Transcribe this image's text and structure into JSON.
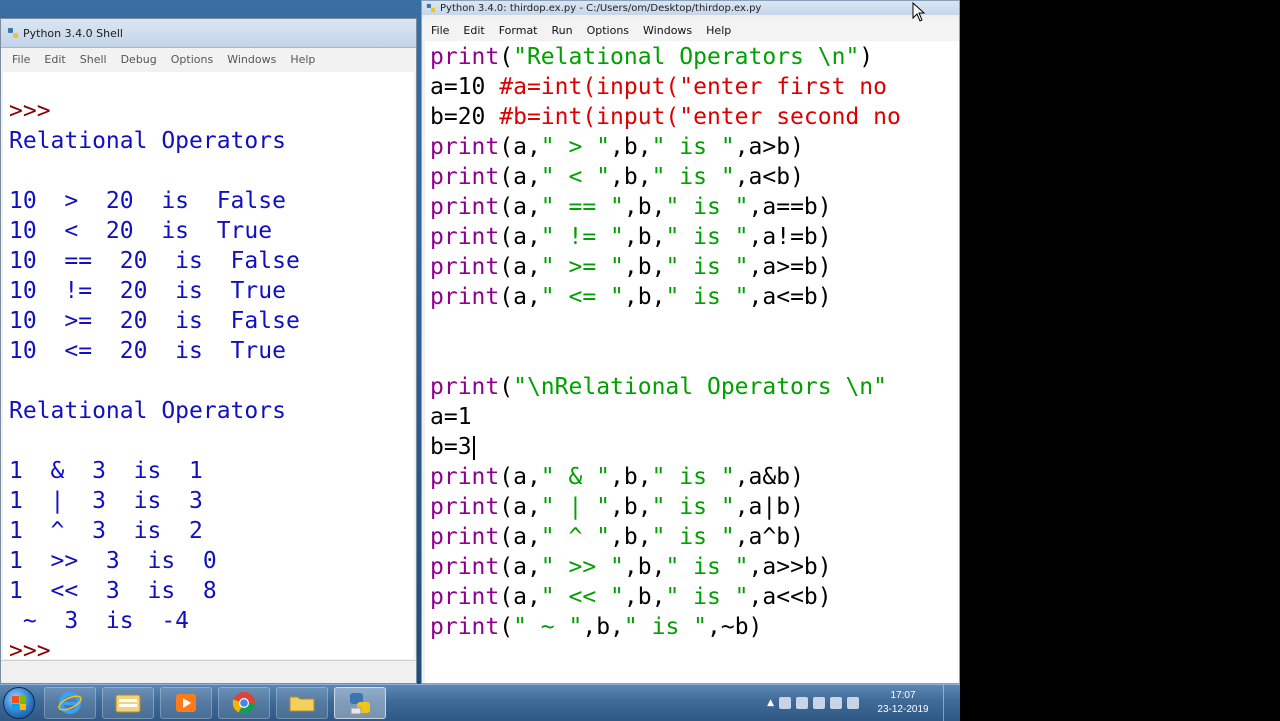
{
  "shell": {
    "title": "Python 3.4.0 Shell",
    "menu": [
      "File",
      "Edit",
      "Shell",
      "Debug",
      "Options",
      "Windows",
      "Help"
    ],
    "lines": [
      [
        {
          "t": ">>>",
          "c": "prompt"
        }
      ],
      [
        {
          "t": "Relational Operators",
          "c": "out"
        }
      ],
      [
        {
          "t": "",
          "c": "out"
        }
      ],
      [
        {
          "t": "10  >  20  is  False",
          "c": "out"
        }
      ],
      [
        {
          "t": "10  <  20  is  True",
          "c": "out"
        }
      ],
      [
        {
          "t": "10  ==  20  is  False",
          "c": "out"
        }
      ],
      [
        {
          "t": "10  !=  20  is  True",
          "c": "out"
        }
      ],
      [
        {
          "t": "10  >=  20  is  False",
          "c": "out"
        }
      ],
      [
        {
          "t": "10  <=  20  is  True",
          "c": "out"
        }
      ],
      [
        {
          "t": "",
          "c": "out"
        }
      ],
      [
        {
          "t": "Relational Operators",
          "c": "out"
        }
      ],
      [
        {
          "t": "",
          "c": "out"
        }
      ],
      [
        {
          "t": "1  &  3  is  1",
          "c": "out"
        }
      ],
      [
        {
          "t": "1  |  3  is  3",
          "c": "out"
        }
      ],
      [
        {
          "t": "1  ^  3  is  2",
          "c": "out"
        }
      ],
      [
        {
          "t": "1  >>  3  is  0",
          "c": "out"
        }
      ],
      [
        {
          "t": "1  <<  3  is  8",
          "c": "out"
        }
      ],
      [
        {
          "t": " ~  3  is  -4",
          "c": "out"
        }
      ],
      [
        {
          "t": ">>>",
          "c": "prompt"
        }
      ]
    ]
  },
  "editor": {
    "title": "Python 3.4.0: thirdop.ex.py - C:/Users/om/Desktop/thirdop.ex.py",
    "menu": [
      "File",
      "Edit",
      "Format",
      "Run",
      "Options",
      "Windows",
      "Help"
    ],
    "lines": [
      [
        {
          "t": "print",
          "c": "kw"
        },
        {
          "t": "(",
          "c": "op"
        },
        {
          "t": "\"Relational Operators \\n\"",
          "c": "st"
        },
        {
          "t": ")",
          "c": "op"
        }
      ],
      [
        {
          "t": "a=10 ",
          "c": "op"
        },
        {
          "t": "#a=int(input(\"enter first no",
          "c": "cm"
        }
      ],
      [
        {
          "t": "b=20 ",
          "c": "op"
        },
        {
          "t": "#b=int(input(\"enter second no",
          "c": "cm"
        }
      ],
      [
        {
          "t": "print",
          "c": "kw"
        },
        {
          "t": "(a,",
          "c": "op"
        },
        {
          "t": "\" > \"",
          "c": "st"
        },
        {
          "t": ",b,",
          "c": "op"
        },
        {
          "t": "\" is \"",
          "c": "st"
        },
        {
          "t": ",a>b)",
          "c": "op"
        }
      ],
      [
        {
          "t": "print",
          "c": "kw"
        },
        {
          "t": "(a,",
          "c": "op"
        },
        {
          "t": "\" < \"",
          "c": "st"
        },
        {
          "t": ",b,",
          "c": "op"
        },
        {
          "t": "\" is \"",
          "c": "st"
        },
        {
          "t": ",a<b)",
          "c": "op"
        }
      ],
      [
        {
          "t": "print",
          "c": "kw"
        },
        {
          "t": "(a,",
          "c": "op"
        },
        {
          "t": "\" == \"",
          "c": "st"
        },
        {
          "t": ",b,",
          "c": "op"
        },
        {
          "t": "\" is \"",
          "c": "st"
        },
        {
          "t": ",a==b)",
          "c": "op"
        }
      ],
      [
        {
          "t": "print",
          "c": "kw"
        },
        {
          "t": "(a,",
          "c": "op"
        },
        {
          "t": "\" != \"",
          "c": "st"
        },
        {
          "t": ",b,",
          "c": "op"
        },
        {
          "t": "\" is \"",
          "c": "st"
        },
        {
          "t": ",a!=b)",
          "c": "op"
        }
      ],
      [
        {
          "t": "print",
          "c": "kw"
        },
        {
          "t": "(a,",
          "c": "op"
        },
        {
          "t": "\" >= \"",
          "c": "st"
        },
        {
          "t": ",b,",
          "c": "op"
        },
        {
          "t": "\" is \"",
          "c": "st"
        },
        {
          "t": ",a>=b)",
          "c": "op"
        }
      ],
      [
        {
          "t": "print",
          "c": "kw"
        },
        {
          "t": "(a,",
          "c": "op"
        },
        {
          "t": "\" <= \"",
          "c": "st"
        },
        {
          "t": ",b,",
          "c": "op"
        },
        {
          "t": "\" is \"",
          "c": "st"
        },
        {
          "t": ",a<=b)",
          "c": "op"
        }
      ],
      [
        {
          "t": "",
          "c": "op"
        }
      ],
      [
        {
          "t": "",
          "c": "op"
        }
      ],
      [
        {
          "t": "print",
          "c": "kw"
        },
        {
          "t": "(",
          "c": "op"
        },
        {
          "t": "\"\\nRelational Operators \\n\"",
          "c": "st"
        }
      ],
      [
        {
          "t": "a=1",
          "c": "op"
        }
      ],
      [
        {
          "t": "b=3",
          "c": "op"
        }
      ],
      [
        {
          "t": "print",
          "c": "kw"
        },
        {
          "t": "(a,",
          "c": "op"
        },
        {
          "t": "\" & \"",
          "c": "st"
        },
        {
          "t": ",b,",
          "c": "op"
        },
        {
          "t": "\" is \"",
          "c": "st"
        },
        {
          "t": ",a&b)",
          "c": "op"
        }
      ],
      [
        {
          "t": "print",
          "c": "kw"
        },
        {
          "t": "(a,",
          "c": "op"
        },
        {
          "t": "\" | \"",
          "c": "st"
        },
        {
          "t": ",b,",
          "c": "op"
        },
        {
          "t": "\" is \"",
          "c": "st"
        },
        {
          "t": ",a|b)",
          "c": "op"
        }
      ],
      [
        {
          "t": "print",
          "c": "kw"
        },
        {
          "t": "(a,",
          "c": "op"
        },
        {
          "t": "\" ^ \"",
          "c": "st"
        },
        {
          "t": ",b,",
          "c": "op"
        },
        {
          "t": "\" is \"",
          "c": "st"
        },
        {
          "t": ",a^b)",
          "c": "op"
        }
      ],
      [
        {
          "t": "print",
          "c": "kw"
        },
        {
          "t": "(a,",
          "c": "op"
        },
        {
          "t": "\" >> \"",
          "c": "st"
        },
        {
          "t": ",b,",
          "c": "op"
        },
        {
          "t": "\" is \"",
          "c": "st"
        },
        {
          "t": ",a>>b)",
          "c": "op"
        }
      ],
      [
        {
          "t": "print",
          "c": "kw"
        },
        {
          "t": "(a,",
          "c": "op"
        },
        {
          "t": "\" << \"",
          "c": "st"
        },
        {
          "t": ",b,",
          "c": "op"
        },
        {
          "t": "\" is \"",
          "c": "st"
        },
        {
          "t": ",a<<b)",
          "c": "op"
        }
      ],
      [
        {
          "t": "print",
          "c": "kw"
        },
        {
          "t": "(",
          "c": "op"
        },
        {
          "t": "\" ~ \"",
          "c": "st"
        },
        {
          "t": ",b,",
          "c": "op"
        },
        {
          "t": "\" is \"",
          "c": "st"
        },
        {
          "t": ",~b)",
          "c": "op"
        }
      ]
    ],
    "caret_line": 13
  },
  "taskbar": {
    "apps": [
      "internet-explorer-icon",
      "file-explorer-icon",
      "media-player-icon",
      "chrome-icon",
      "folder-icon",
      "python-icon"
    ],
    "active_app": 5,
    "clock_time": "17:07",
    "clock_date": "23-12-2019"
  }
}
